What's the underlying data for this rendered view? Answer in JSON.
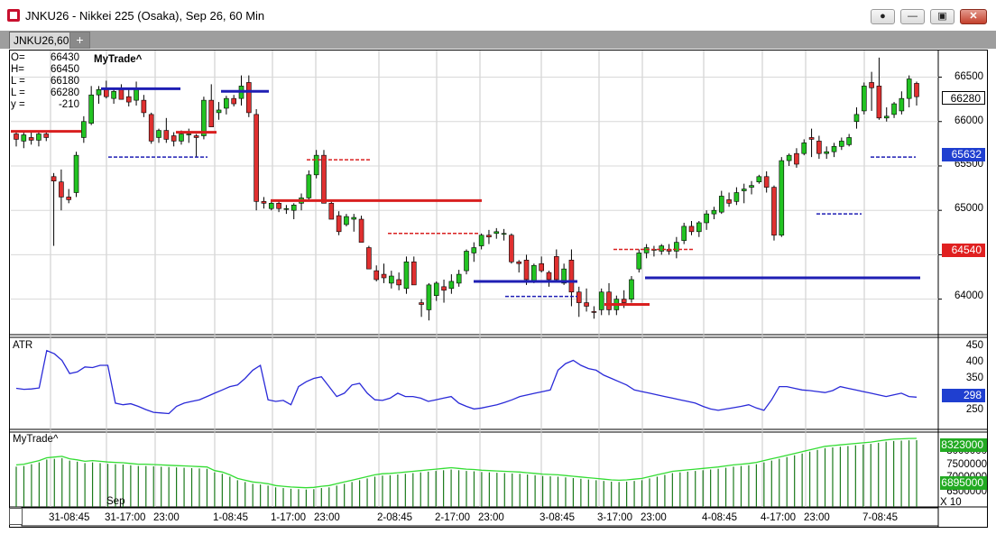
{
  "window": {
    "title": "JNKU26 - Nikkei 225 (Osaka), Sep 26, 60 Min",
    "buttons": {
      "record": "●",
      "minimize": "—",
      "restore": "▣",
      "close": "✕"
    }
  },
  "tabs": [
    {
      "label": "JNKU26,60"
    }
  ],
  "tab_add_label": "+",
  "ohlc": [
    {
      "k": "O=",
      "v": "66430"
    },
    {
      "k": "H=",
      "v": "66450"
    },
    {
      "k": "L =",
      "v": "66180"
    },
    {
      "k": "L =",
      "v": "66280"
    },
    {
      "k": "y =",
      "v": "-210"
    }
  ],
  "studies": {
    "mytrade_main": "MyTrade^",
    "atr": "ATR",
    "mytrade_sub": "MyTrade^"
  },
  "price_axis": {
    "ticks": [
      "66500",
      "66000",
      "65500",
      "65000",
      "64500",
      "64000"
    ],
    "badges": {
      "last": "66280",
      "stop_blue": "65632",
      "stop_red": "64540"
    }
  },
  "atr_axis": {
    "ticks": [
      "450",
      "400",
      "350",
      "300",
      "250"
    ],
    "badge": "298"
  },
  "sub_axis": {
    "ticks": [
      "8000000",
      "7500000",
      "7000000",
      "6500000"
    ],
    "badge_top": "8323000",
    "badge_bottom": "6895000",
    "multiplier": "X 10"
  },
  "time_axis": {
    "month_label": "Sep",
    "labels": [
      "31-08:45",
      "31-17:00",
      "23:00",
      "1-08:45",
      "1-17:00",
      "23:00",
      "2-08:45",
      "2-17:00",
      "23:00",
      "3-08:45",
      "3-17:00",
      "23:00",
      "4-08:45",
      "4-17:00",
      "23:00",
      "7-08:45"
    ]
  },
  "colors": {
    "up": "#22c322",
    "down": "#e03030",
    "stop_blue": "#1f1fb4",
    "stop_red": "#d92020",
    "atr_line": "#2a2ad8",
    "sub_line": "#33dd33",
    "sub_bars": "#1b7a1b",
    "badge_blue": "#1f3fd0",
    "badge_red": "#e02020",
    "badge_green": "#22aa22"
  },
  "chart_data": {
    "type": "candlestick",
    "price_range": [
      63600,
      66800
    ],
    "candles": [
      [
        65860,
        65900,
        65720,
        65800
      ],
      [
        65780,
        65880,
        65700,
        65850
      ],
      [
        65820,
        65880,
        65740,
        65790
      ],
      [
        65790,
        65880,
        65720,
        65860
      ],
      [
        65860,
        65900,
        65780,
        65820
      ],
      [
        65380,
        65420,
        64600,
        65330
      ],
      [
        65320,
        65460,
        65000,
        65150
      ],
      [
        65150,
        65240,
        65080,
        65120
      ],
      [
        65200,
        65660,
        65150,
        65620
      ],
      [
        65820,
        66060,
        65760,
        66000
      ],
      [
        65980,
        66400,
        65960,
        66300
      ],
      [
        66300,
        66400,
        66200,
        66360
      ],
      [
        66360,
        66460,
        66260,
        66280
      ],
      [
        66260,
        66380,
        66200,
        66340
      ],
      [
        66360,
        66420,
        66250,
        66250
      ],
      [
        66280,
        66360,
        66170,
        66220
      ],
      [
        66240,
        66450,
        66180,
        66380
      ],
      [
        66240,
        66300,
        66050,
        66100
      ],
      [
        66080,
        66100,
        65750,
        65780
      ],
      [
        65820,
        65920,
        65760,
        65900
      ],
      [
        65900,
        66040,
        65760,
        65800
      ],
      [
        65840,
        65880,
        65720,
        65780
      ],
      [
        65780,
        65900,
        65740,
        65860
      ],
      [
        65860,
        65920,
        65760,
        65860
      ],
      [
        65840,
        65860,
        65600,
        65820
      ],
      [
        65840,
        66280,
        65800,
        66240
      ],
      [
        66240,
        66420,
        65960,
        65940
      ],
      [
        66100,
        66220,
        66020,
        66130
      ],
      [
        66150,
        66290,
        66080,
        66260
      ],
      [
        66260,
        66300,
        66170,
        66200
      ],
      [
        66260,
        66520,
        66180,
        66400
      ],
      [
        66440,
        66520,
        66050,
        66100
      ],
      [
        66080,
        66140,
        65000,
        65100
      ],
      [
        65100,
        65150,
        65020,
        65080
      ],
      [
        65020,
        65110,
        65000,
        65080
      ],
      [
        65080,
        65120,
        64980,
        65020
      ],
      [
        65020,
        65060,
        64960,
        65020
      ],
      [
        65000,
        65080,
        64900,
        65060
      ],
      [
        65080,
        65190,
        65000,
        65140
      ],
      [
        65140,
        65450,
        65100,
        65400
      ],
      [
        65400,
        65680,
        65360,
        65620
      ],
      [
        65620,
        65680,
        65100,
        65080
      ],
      [
        65080,
        65120,
        64900,
        64900
      ],
      [
        64940,
        64990,
        64720,
        64760
      ],
      [
        64840,
        64960,
        64820,
        64930
      ],
      [
        64900,
        64960,
        64760,
        64920
      ],
      [
        64900,
        64940,
        64640,
        64640
      ],
      [
        64580,
        64600,
        64360,
        64340
      ],
      [
        64320,
        64380,
        64200,
        64220
      ],
      [
        64280,
        64400,
        64180,
        64240
      ],
      [
        64180,
        64320,
        64120,
        64260
      ],
      [
        64220,
        64300,
        64100,
        64160
      ],
      [
        64120,
        64480,
        64060,
        64420
      ],
      [
        64420,
        64480,
        64160,
        64160
      ],
      [
        63960,
        64000,
        63800,
        63940
      ],
      [
        63880,
        64180,
        63760,
        64160
      ],
      [
        64040,
        64200,
        63980,
        64180
      ],
      [
        64140,
        64220,
        63960,
        64100
      ],
      [
        64120,
        64280,
        64060,
        64200
      ],
      [
        64180,
        64330,
        64140,
        64280
      ],
      [
        64320,
        64560,
        64280,
        64540
      ],
      [
        64520,
        64640,
        64420,
        64580
      ],
      [
        64600,
        64740,
        64560,
        64720
      ],
      [
        64720,
        64780,
        64620,
        64700
      ],
      [
        64740,
        64800,
        64680,
        64760
      ],
      [
        64740,
        64790,
        64660,
        64740
      ],
      [
        64720,
        64740,
        64400,
        64420
      ],
      [
        64420,
        64440,
        64300,
        64400
      ],
      [
        64440,
        64500,
        64160,
        64220
      ],
      [
        64200,
        64400,
        64180,
        64380
      ],
      [
        64400,
        64480,
        64300,
        64320
      ],
      [
        64300,
        64320,
        64140,
        64220
      ],
      [
        64480,
        64560,
        64200,
        64220
      ],
      [
        64180,
        64400,
        64160,
        64340
      ],
      [
        64440,
        64560,
        63920,
        64080
      ],
      [
        64080,
        64140,
        63800,
        63960
      ],
      [
        63960,
        64120,
        63860,
        63920
      ],
      [
        63860,
        63920,
        63780,
        63850
      ],
      [
        63880,
        64120,
        63820,
        64080
      ],
      [
        64080,
        64180,
        63820,
        63880
      ],
      [
        63880,
        64040,
        63820,
        64000
      ],
      [
        64000,
        64100,
        63900,
        63960
      ],
      [
        64000,
        64260,
        63960,
        64220
      ],
      [
        64340,
        64560,
        64300,
        64520
      ],
      [
        64520,
        64620,
        64460,
        64580
      ],
      [
        64560,
        64600,
        64480,
        64560
      ],
      [
        64540,
        64620,
        64500,
        64600
      ],
      [
        64560,
        64620,
        64500,
        64540
      ],
      [
        64540,
        64700,
        64460,
        64640
      ],
      [
        64660,
        64860,
        64620,
        64820
      ],
      [
        64820,
        64880,
        64720,
        64760
      ],
      [
        64760,
        64880,
        64700,
        64860
      ],
      [
        64860,
        65000,
        64780,
        64960
      ],
      [
        64960,
        65040,
        64900,
        65000
      ],
      [
        64980,
        65220,
        64960,
        65160
      ],
      [
        65120,
        65200,
        65040,
        65080
      ],
      [
        65100,
        65260,
        65060,
        65200
      ],
      [
        65220,
        65300,
        65080,
        65240
      ],
      [
        65260,
        65330,
        65180,
        65280
      ],
      [
        65320,
        65400,
        65300,
        65380
      ],
      [
        65380,
        65440,
        65200,
        65260
      ],
      [
        65260,
        65280,
        64660,
        64720
      ],
      [
        64720,
        65600,
        64700,
        65560
      ],
      [
        65560,
        65640,
        65500,
        65620
      ],
      [
        65640,
        65700,
        65480,
        65520
      ],
      [
        65640,
        65800,
        65620,
        65760
      ],
      [
        65820,
        65920,
        65600,
        65800
      ],
      [
        65780,
        65840,
        65580,
        65640
      ],
      [
        65640,
        65720,
        65580,
        65660
      ],
      [
        65660,
        65760,
        65600,
        65720
      ],
      [
        65720,
        65820,
        65680,
        65780
      ],
      [
        65740,
        65860,
        65720,
        65820
      ],
      [
        66000,
        66160,
        65920,
        66080
      ],
      [
        66120,
        66440,
        66080,
        66400
      ],
      [
        66440,
        66560,
        66120,
        66380
      ],
      [
        66400,
        66720,
        66020,
        66040
      ],
      [
        66040,
        66160,
        66000,
        66060
      ],
      [
        66080,
        66220,
        66040,
        66200
      ],
      [
        66120,
        66340,
        66080,
        66260
      ],
      [
        66260,
        66520,
        66160,
        66480
      ],
      [
        66430,
        66450,
        66180,
        66280
      ]
    ],
    "atr": {
      "range": [
        200,
        480
      ],
      "values": [
        325,
        322,
        323,
        326,
        440,
        430,
        410,
        370,
        375,
        390,
        388,
        395,
        395,
        280,
        275,
        278,
        270,
        260,
        252,
        250,
        248,
        270,
        280,
        285,
        290,
        300,
        310,
        320,
        330,
        335,
        355,
        380,
        395,
        290,
        285,
        288,
        275,
        330,
        345,
        355,
        360,
        330,
        300,
        310,
        335,
        340,
        310,
        290,
        288,
        295,
        310,
        300,
        300,
        295,
        285,
        290,
        295,
        300,
        280,
        270,
        262,
        265,
        270,
        275,
        282,
        290,
        300,
        305,
        310,
        315,
        320,
        380,
        400,
        410,
        395,
        385,
        380,
        365,
        355,
        345,
        335,
        320,
        315,
        310,
        305,
        300,
        295,
        290,
        285,
        280,
        270,
        262,
        258,
        262,
        266,
        270,
        275,
        265,
        258,
        290,
        330,
        330,
        325,
        320,
        318,
        315,
        312,
        318,
        330,
        325,
        320,
        315,
        310,
        305,
        300,
        305,
        310,
        300,
        298
      ]
    },
    "mytrade_sub": {
      "range": [
        6400000,
        8500000
      ],
      "line_values": [
        7580000,
        7600000,
        7650000,
        7700000,
        7780000,
        7800000,
        7820000,
        7750000,
        7720000,
        7680000,
        7700000,
        7680000,
        7660000,
        7650000,
        7640000,
        7620000,
        7600000,
        7600000,
        7590000,
        7580000,
        7570000,
        7560000,
        7550000,
        7540000,
        7530000,
        7520000,
        7420000,
        7380000,
        7300000,
        7200000,
        7150000,
        7100000,
        7080000,
        7050000,
        7000000,
        6980000,
        6960000,
        6950000,
        6940000,
        6950000,
        6980000,
        7000000,
        7050000,
        7100000,
        7150000,
        7200000,
        7250000,
        7300000,
        7330000,
        7340000,
        7360000,
        7380000,
        7400000,
        7420000,
        7440000,
        7460000,
        7480000,
        7500000,
        7480000,
        7460000,
        7450000,
        7430000,
        7420000,
        7410000,
        7400000,
        7390000,
        7380000,
        7360000,
        7340000,
        7320000,
        7310000,
        7300000,
        7280000,
        7260000,
        7240000,
        7220000,
        7200000,
        7180000,
        7160000,
        7150000,
        7160000,
        7180000,
        7200000,
        7250000,
        7300000,
        7350000,
        7400000,
        7420000,
        7440000,
        7460000,
        7480000,
        7500000,
        7520000,
        7550000,
        7580000,
        7600000,
        7620000,
        7650000,
        7700000,
        7750000,
        7800000,
        7850000,
        7900000,
        7950000,
        8000000,
        8050000,
        8100000,
        8120000,
        8140000,
        8160000,
        8180000,
        8200000,
        8220000,
        8250000,
        8280000,
        8300000,
        8310000,
        8320000,
        8323000
      ]
    }
  }
}
